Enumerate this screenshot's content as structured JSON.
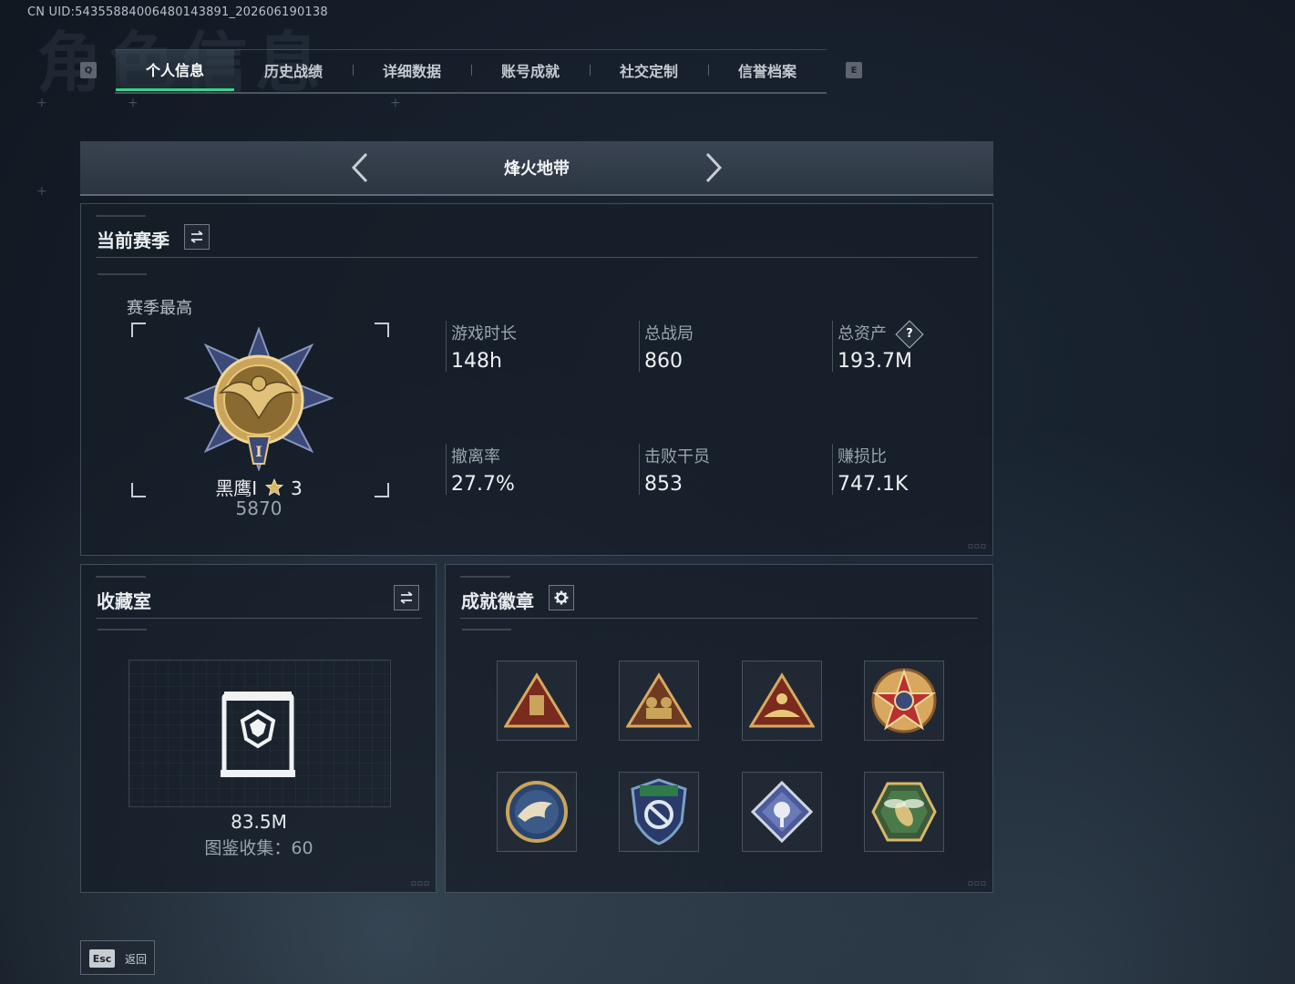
{
  "uid_text": "CN UID:54355884006480143891_202606190138",
  "bg_title": "角色信息",
  "tabs": {
    "prev_key": "Q",
    "next_key": "E",
    "items": [
      {
        "label": "个人信息",
        "active": true
      },
      {
        "label": "历史战绩"
      },
      {
        "label": "详细数据"
      },
      {
        "label": "账号成就"
      },
      {
        "label": "社交定制"
      },
      {
        "label": "信誉档案"
      }
    ]
  },
  "mode": {
    "title": "烽火地带"
  },
  "season": {
    "title": "当前赛季",
    "best_label": "赛季最高",
    "rank_name": "黑鹰I",
    "rank_stars": "3",
    "rank_score": "5870",
    "stats": [
      {
        "label": "游戏时长",
        "value": "148h"
      },
      {
        "label": "总战局",
        "value": "860"
      },
      {
        "label": "总资产",
        "value": "193.7M",
        "help": "?"
      },
      {
        "label": "撤离率",
        "value": "27.7%"
      },
      {
        "label": "击败干员",
        "value": "853"
      },
      {
        "label": "赚损比",
        "value": "747.1K"
      }
    ]
  },
  "collection": {
    "title": "收藏室",
    "value": "83.5M",
    "count_label": "图鉴收集：60"
  },
  "badges": {
    "title": "成就徽章",
    "items": [
      "triangle-badge-crate",
      "triangle-badge-soldiers",
      "triangle-badge-hands",
      "star-medal-badge",
      "eagle-round-badge",
      "shield-badge",
      "rose-diamond-badge",
      "hexagon-wasp-badge"
    ]
  },
  "footer": {
    "esc_key": "Esc",
    "esc_label": "返回"
  },
  "colors": {
    "accent": "#3ad48a",
    "gold": "#c9a45a"
  }
}
